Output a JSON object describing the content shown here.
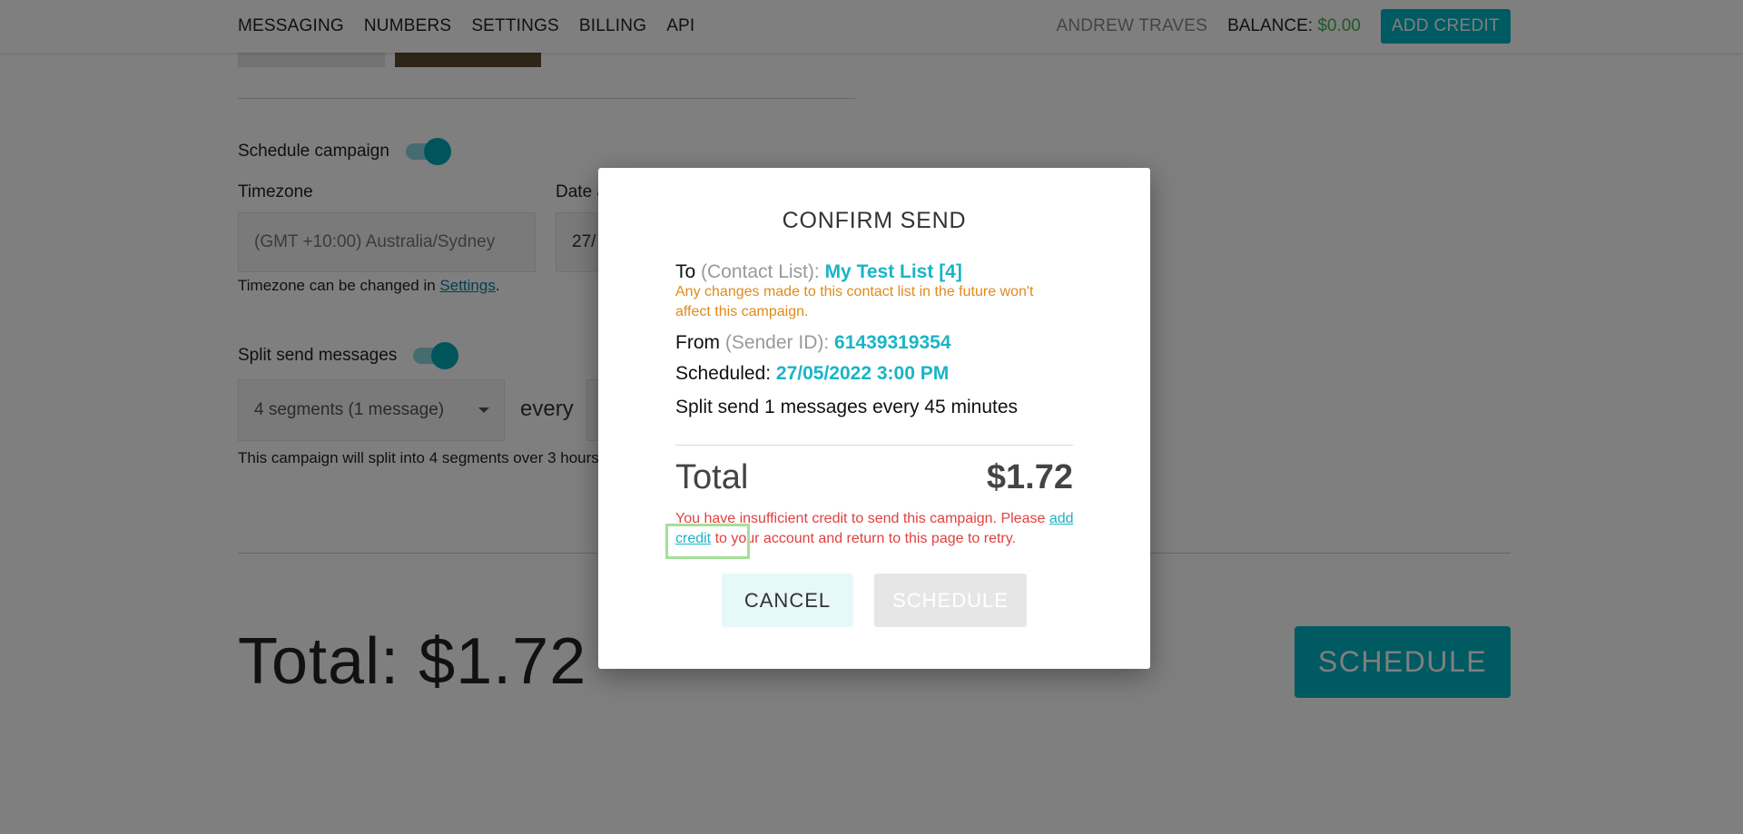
{
  "nav": {
    "items": [
      "MESSAGING",
      "NUMBERS",
      "SETTINGS",
      "BILLING",
      "API"
    ],
    "user_name": "ANDREW TRAVES",
    "balance_label": "BALANCE:",
    "balance_value": "$0.00",
    "add_credit": "ADD CREDIT"
  },
  "page": {
    "schedule_label": "Schedule campaign",
    "timezone_label": "Timezone",
    "date_label": "Date a",
    "timezone_value": "(GMT +10:00) Australia/Sydney",
    "date_value_partial": "27/",
    "timezone_hint_prefix": "Timezone can be changed in ",
    "timezone_hint_link": "Settings",
    "timezone_hint_suffix": ".",
    "split_label": "Split send messages",
    "segments_value": "4 segments (1 message)",
    "every_label": "every",
    "split_hint": "This campaign will split into 4 segments over 3 hours.",
    "total_label": "Total: $1.72",
    "schedule_button": "SCHEDULE"
  },
  "modal": {
    "title": "CONFIRM SEND",
    "to_prefix": "To ",
    "to_muted": "(Contact List): ",
    "to_value": "My Test List [4]",
    "to_warning": "Any changes made to this contact list in the future won't affect this campaign.",
    "from_prefix": "From ",
    "from_muted": "(Sender ID): ",
    "from_value": "61439319354",
    "scheduled_prefix": "Scheduled: ",
    "scheduled_value": "27/05/2022 3:00 PM",
    "split_text": "Split send 1 messages every 45 minutes",
    "total_label": "Total",
    "total_value": "$1.72",
    "error_prefix": "You have insufficient credit to send this campaign. Please ",
    "error_link": "add credit",
    "error_suffix": " to your account and return to this page to retry.",
    "cancel_button": "CANCEL",
    "schedule_button": "SCHEDULE"
  }
}
